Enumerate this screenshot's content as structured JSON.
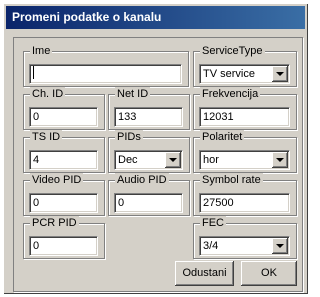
{
  "window": {
    "title": "Promeni podatke o kanalu"
  },
  "fields": {
    "ime": {
      "label": "Ime",
      "value": ""
    },
    "service_type": {
      "label": "ServiceType",
      "value": "TV service"
    },
    "ch_id": {
      "label": "Ch. ID",
      "value": "0"
    },
    "net_id": {
      "label": "Net ID",
      "value": "133"
    },
    "frekvencija": {
      "label": "Frekvencija",
      "value": "12031"
    },
    "ts_id": {
      "label": "TS ID",
      "value": "4"
    },
    "pids": {
      "label": "PIDs",
      "value": "Dec"
    },
    "polaritet": {
      "label": "Polaritet",
      "value": "hor"
    },
    "video_pid": {
      "label": "Video PID",
      "value": "0"
    },
    "audio_pid": {
      "label": "Audio PID",
      "value": "0"
    },
    "symbol_rate": {
      "label": "Symbol rate",
      "value": "27500"
    },
    "pcr_pid": {
      "label": "PCR PID",
      "value": "0"
    },
    "fec": {
      "label": "FEC",
      "value": "3/4"
    }
  },
  "buttons": {
    "cancel": "Odustani",
    "ok": "OK"
  },
  "icons": {
    "dropdown": "chevron-down-icon"
  }
}
